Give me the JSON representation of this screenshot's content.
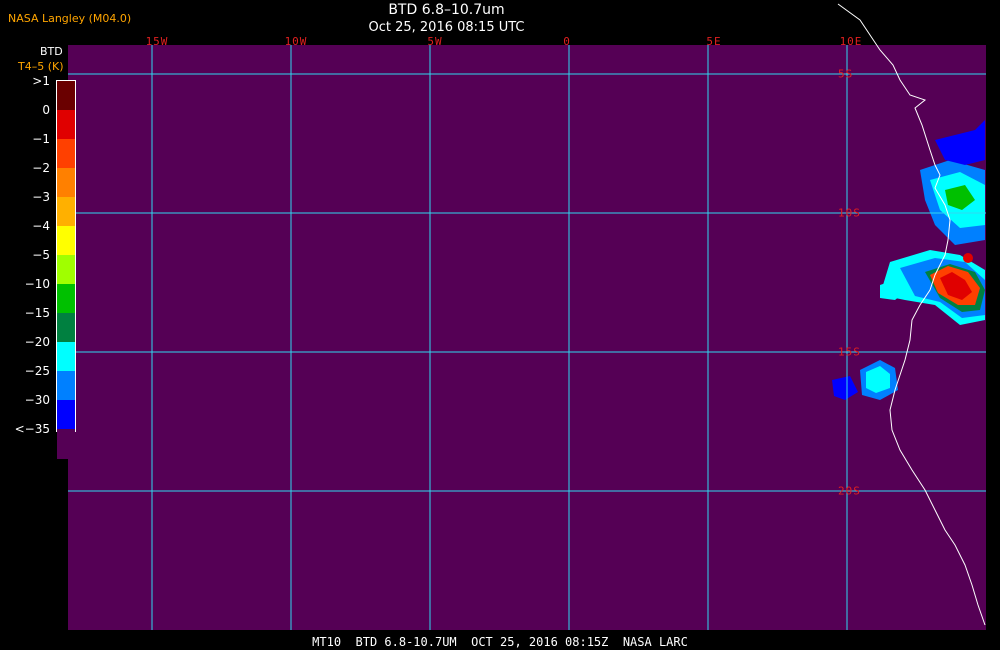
{
  "header": {
    "credit": "NASA Langley (M04.0)",
    "title": "BTD 6.8–10.7um",
    "datetime": "Oct 25, 2016 08:15 UTC"
  },
  "legend": {
    "title": "BTD",
    "unit": "T4–5 (K)",
    "labels": [
      ">1",
      "0",
      "−1",
      "−2",
      "−3",
      "−4",
      "−5",
      "−10",
      "−15",
      "−20",
      "−25",
      "−30",
      "<−35"
    ],
    "colors": [
      "#6a0000",
      "#e00000",
      "#ff4000",
      "#ff8000",
      "#ffb000",
      "#ffff00",
      "#a0ff00",
      "#00c000",
      "#008040",
      "#00ffff",
      "#0080ff",
      "#0000ff",
      "#550055"
    ]
  },
  "map": {
    "background_color": "#550055",
    "grid_color": "#30d8f0",
    "coast_color": "#ffffff",
    "lon_labels": [
      "15W",
      "10W",
      "5W",
      "0",
      "5E",
      "10E"
    ],
    "lat_labels": [
      "5S",
      "10S",
      "15S",
      "20S"
    ]
  },
  "footer": {
    "text": "MT10  BTD 6.8-10.7UM  OCT 25, 2016 08:15Z  NASA LARC"
  }
}
